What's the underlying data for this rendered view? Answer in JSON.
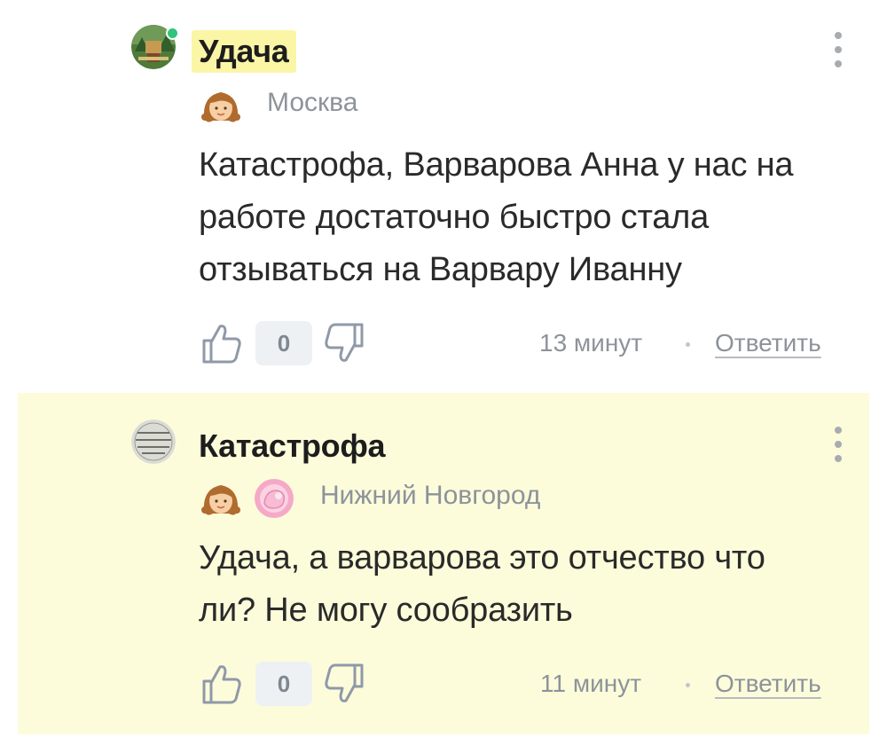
{
  "comments": [
    {
      "author": "Удача",
      "online": true,
      "city": "Москва",
      "text_lines": [
        "Катастрофа, Варварова Анна у нас на",
        "работе достаточно быстро стала",
        "отзываться на Варвару Иванну"
      ],
      "score": "0",
      "time": "13 минут",
      "reply_label": "Ответить",
      "badges": [
        "girl-avatar-badge"
      ]
    },
    {
      "author": "Катастрофа",
      "online": false,
      "city": "Нижний Новгород",
      "text_lines": [
        "Удача, а варварова это отчество что",
        "ли? Не могу сообразить"
      ],
      "score": "0",
      "time": "11 минут",
      "reply_label": "Ответить",
      "badges": [
        "girl-avatar-badge",
        "pink-baby-badge"
      ]
    }
  ],
  "colors": {
    "highlight_bg": "#fcfcdb",
    "author_highlight": "#fbf6a6",
    "online": "#2fc47a",
    "muted_text": "#8d939a"
  }
}
